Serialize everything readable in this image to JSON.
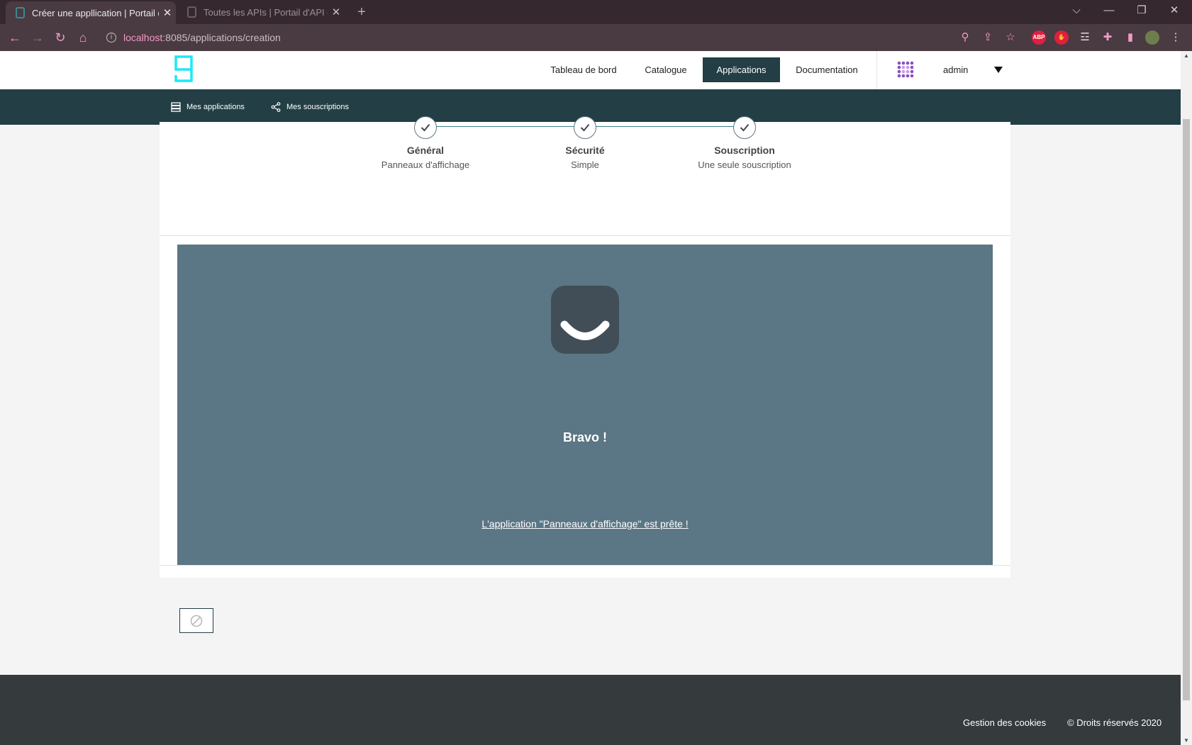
{
  "browser": {
    "tabs": [
      {
        "title": "Créer une appllication | Portail d'",
        "close": "✕",
        "active": true
      },
      {
        "title": "Toutes les APIs | Portail d'API de",
        "close": "✕",
        "active": false
      }
    ],
    "new_tab": "+",
    "address": {
      "host": "localhost",
      "path": ":8085/applications/creation"
    },
    "extensions": [
      "ABP"
    ]
  },
  "nav": {
    "items": [
      {
        "label": "Tableau de bord",
        "active": false
      },
      {
        "label": "Catalogue",
        "active": false
      },
      {
        "label": "Applications",
        "active": true
      },
      {
        "label": "Documentation",
        "active": false
      }
    ],
    "user": "admin"
  },
  "subnav": {
    "my_apps": "Mes applications",
    "my_subscriptions": "Mes souscriptions"
  },
  "steps": [
    {
      "title": "Général",
      "subtitle": "Panneaux d'affichage"
    },
    {
      "title": "Sécurité",
      "subtitle": "Simple"
    },
    {
      "title": "Souscription",
      "subtitle": "Une seule souscription"
    }
  ],
  "result": {
    "title": "Bravo !",
    "message": "L'application \"Panneaux d'affichage\" est prête !"
  },
  "footer": {
    "cookies": "Gestion des cookies",
    "rights": "© Droits réservés 2020"
  },
  "colors": {
    "primary": "#233e45",
    "panel": "#5b7684",
    "footer": "#353a3d",
    "logo": "#1de9f5"
  }
}
